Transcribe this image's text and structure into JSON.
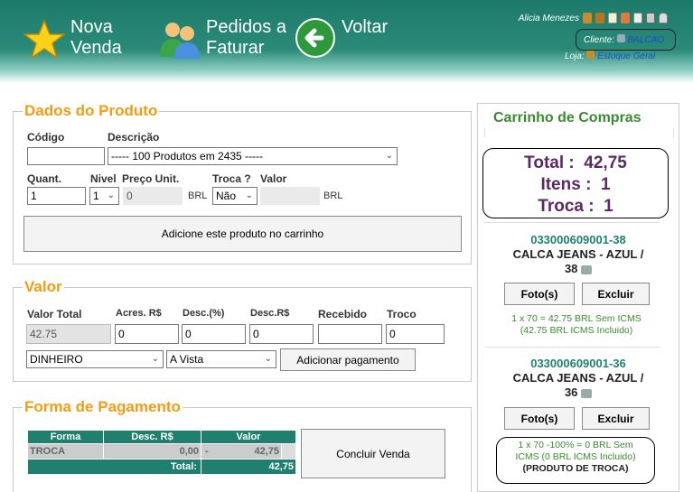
{
  "nav": {
    "nova_venda": [
      "Nova",
      "Venda"
    ],
    "pedidos": [
      "Pedidos a",
      "Faturar"
    ],
    "voltar": "Voltar"
  },
  "user": {
    "name": "Alicia Menezes",
    "cliente_label": "Cliente:",
    "cliente_value": "BALCAO",
    "loja_label": "Loja:",
    "loja_value": "Estoque Geral"
  },
  "produto": {
    "legend": "Dados do Produto",
    "codigo_label": "Código",
    "codigo_value": "",
    "descricao_label": "Descrição",
    "descricao_value": "----- 100 Produtos em 2435 -----",
    "quant_label": "Quant.",
    "quant_value": "1",
    "nivel_label": "Nivel",
    "nivel_value": "1",
    "preco_label": "Preço Unit.",
    "preco_value": "0",
    "currency": "BRL",
    "troca_label": "Troca ?",
    "troca_value": "Não",
    "valor_label": "Valor",
    "valor_value": "",
    "add_button": "Adicione este produto no carrinho"
  },
  "valor": {
    "legend": "Valor",
    "labels": [
      "Valor Total",
      "Acres. R$",
      "Desc.(%)",
      "Desc.R$",
      "Recebido",
      "Troco"
    ],
    "valor_total": "42.75",
    "acres": "0",
    "desc_pct": "0",
    "desc_rs": "0",
    "recebido": "",
    "troco": "0",
    "forma": "DINHEIRO",
    "prazo": "A Vista",
    "add_pagamento": "Adicionar pagamento"
  },
  "pagamento": {
    "legend": "Forma de Pagamento",
    "headers": [
      "Forma",
      "Desc. R$",
      "Valor"
    ],
    "row": {
      "forma": "TROCA",
      "desc": "0,00",
      "sep": "-",
      "valor": "42,75"
    },
    "total_label": "Total:",
    "total_value": "42,75",
    "concluir": "Concluir Venda"
  },
  "cart": {
    "title": "Carrinho de Compras",
    "total_label": "Total :",
    "total_value": "42,75",
    "itens_label": "Itens :",
    "itens_value": "1",
    "troca_label": "Troca :",
    "troca_value": "1",
    "items": [
      {
        "code": "033000609001-38",
        "name_line1": "CALCA JEANS - AZUL /",
        "name_line2": "38",
        "foto": "Foto(s)",
        "excluir": "Excluir",
        "info1": "1 x 70 = 42.75 BRL Sem ICMS",
        "info2": "(42.75 BRL ICMS Incluido)",
        "info3": ""
      },
      {
        "code": "033000609001-36",
        "name_line1": "CALCA JEANS - AZUL /",
        "name_line2": "36",
        "foto": "Foto(s)",
        "excluir": "Excluir",
        "info1": "1 x 70 -100% = 0 BRL Sem",
        "info2": "ICMS (0 BRL ICMS Incluido)",
        "info3": "(PRODUTO DE TROCA)"
      }
    ]
  },
  "colors": {
    "header": "#1d7a6a",
    "accent": "#f39c12",
    "cart_title": "#3a8a2f",
    "table": "#1f8070"
  }
}
